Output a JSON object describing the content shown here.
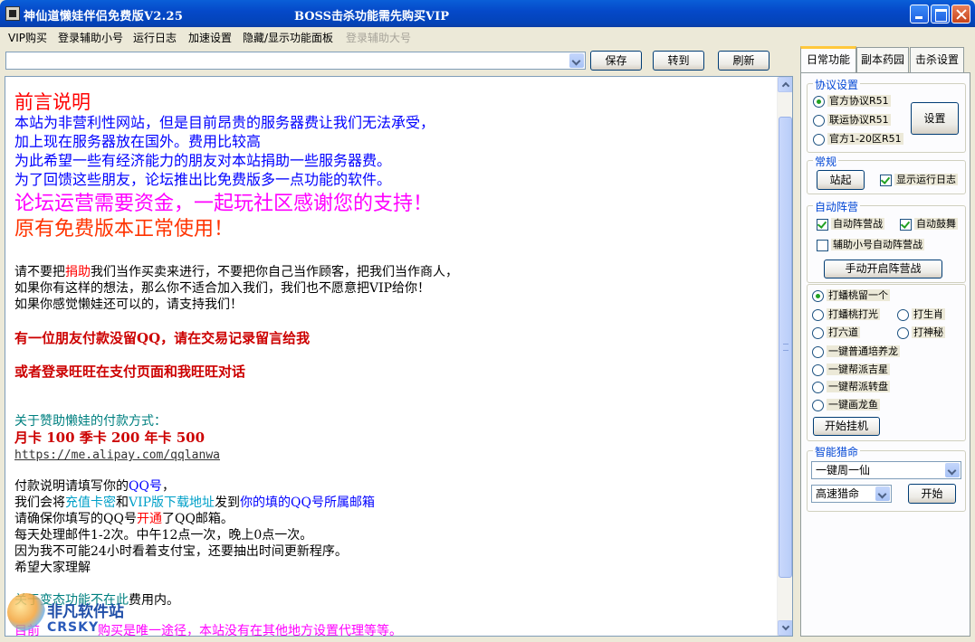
{
  "window": {
    "title": "神仙道懒娃伴侣免费版V2.25",
    "subtitle": "BOSS击杀功能需先购买VIP"
  },
  "menu": {
    "items": [
      "VIP购买",
      "登录辅助小号",
      "运行日志",
      "加速设置",
      "隐藏/显示功能面板"
    ],
    "disabled_item": "登录辅助大号"
  },
  "toolbar": {
    "path_value": "",
    "save_label": "保存",
    "goto_label": "转到",
    "refresh_label": "刷新"
  },
  "document": {
    "lines": [
      "前言说明",
      "本站为非营利性网站，但是目前昂贵的服务器费让我们无法承受，",
      "加上现在服务器放在国外。费用比较高",
      "为此希望一些有经济能力的朋友对本站捐助一些服务器费。",
      "为了回馈这些朋友，论坛推出比免费版多一点功能的软件。",
      "论坛运营需要资金，一起玩社区感谢您的支持！",
      "原有免费版本正常使用！",
      "请不要把",
      "捐助",
      "我们当作买卖来进行，不要把你自己当作顾客，把我们当作商人，",
      "如果你有这样的想法，那么你不适合加入我们，我们也不愿意把VIP给你！",
      "如果你感觉懒娃还可以的，请支持我们！",
      "有一位朋友付款没留QQ，请在交易记录留言给我",
      "或者登录旺旺在支付页面和我旺旺对话",
      "关于赞助懒娃的付款方式：",
      "月卡 100 季卡 200  年卡 500",
      "https://me.alipay.com/qqlanwa",
      "付款说明请填写你的",
      "QQ号",
      "，",
      "我们会将",
      "充值卡密",
      "和",
      "VIP版下载地址",
      "发到",
      "你的填的QQ号所属邮箱",
      "请确保你填写的QQ号",
      "开通",
      "了QQ邮箱。",
      "每天处理邮件1-2次。中午12点一次，晚上0点一次。",
      "因为我不可能24小时看着支付宝，还要抽出时间更新程序。",
      "希望大家理解",
      "关于变态功能不在此",
      "费用内。",
      "目前",
      "购买是唯一途径，本站没有在其他地方设置代理等等。"
    ]
  },
  "watermark": {
    "cn": "非凡软件站",
    "en": "CRSKY"
  },
  "tabs": [
    "日常功能",
    "副本药园",
    "击杀设置"
  ],
  "panel": {
    "protocol": {
      "title": "协议设置",
      "options": [
        "官方协议R51",
        "联运协议R51",
        "官方1-20区R51"
      ],
      "settings_button": "设置"
    },
    "normal": {
      "title": "常规",
      "station_button": "站起",
      "show_log": "显示运行日志"
    },
    "camp": {
      "title": "自动阵营",
      "auto_camp": "自动阵营战",
      "auto_drum": "自动鼓舞",
      "alt_camp": "辅助小号自动阵营战",
      "manual_button": "手动开启阵营战"
    },
    "tasks": {
      "options": [
        "打蟠桃留一个",
        "打蟠桃打光",
        "打生肖",
        "打六道",
        "打神秘",
        "一键普通培养龙",
        "一键帮派吉星",
        "一键帮派转盘",
        "一键画龙鱼"
      ],
      "start_button": "开始挂机"
    },
    "hunt": {
      "title": "智能猎命",
      "mode_value": "一键周一仙",
      "speed_value": "高速猎命",
      "start_button": "开始"
    }
  },
  "colors": {
    "title_bar": "#0549c9",
    "accent_tab": "#ffc83c",
    "group_title": "#0046d5"
  }
}
